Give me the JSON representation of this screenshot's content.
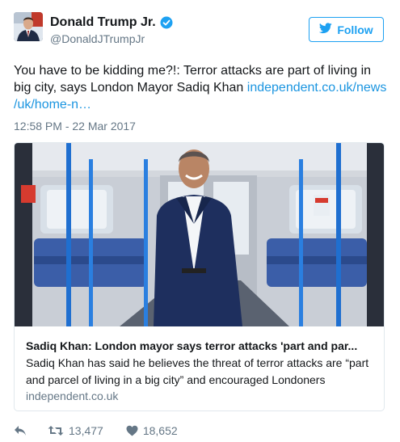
{
  "user": {
    "display_name": "Donald Trump Jr.",
    "handle": "@DonaldJTrumpJr",
    "verified": true
  },
  "follow_button": {
    "label": "Follow",
    "icon": "twitter-bird-icon"
  },
  "tweet": {
    "text": "You have to be kidding me?!: Terror attacks are part of living in big city, says London Mayor Sadiq Khan ",
    "link_text_line1": "independent.co.uk/news",
    "link_text_line2": "/uk/home-n…",
    "timestamp": "12:58 PM - 22 Mar 2017"
  },
  "card": {
    "title": "Sadiq Khan: London mayor says terror attacks 'part and par...",
    "description": "Sadiq Khan has said he believes the threat of terror attacks are “part and parcel of living in a big city” and encouraged Londoners",
    "domain": "independent.co.uk"
  },
  "actions": {
    "reply_icon": "reply-icon",
    "retweet_icon": "retweet-icon",
    "retweet_count": "13,477",
    "like_icon": "heart-icon",
    "like_count": "18,652"
  },
  "colors": {
    "accent": "#1da1f2",
    "link": "#1b95e0",
    "muted": "#657786",
    "border": "#e1e8ed"
  }
}
